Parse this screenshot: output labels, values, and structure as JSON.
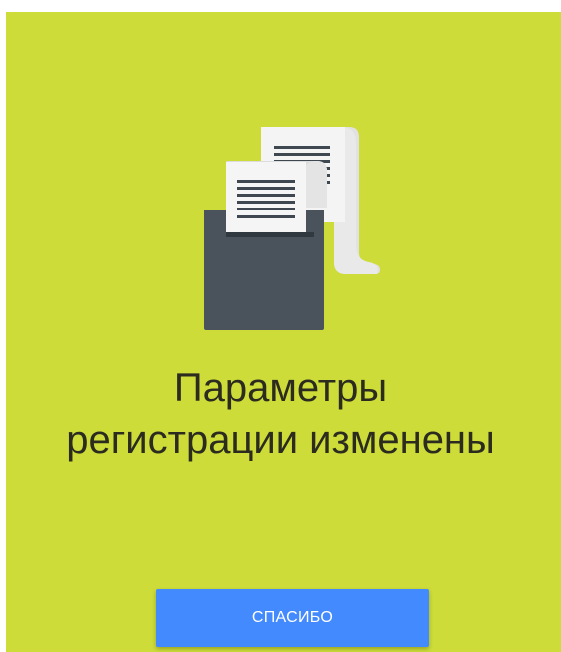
{
  "dialog": {
    "title_line_1": "Параметры",
    "title_line_2": "регистрации изменены",
    "button_label": "СПАСИБО",
    "illustration_icon": "receipt-printer-icon"
  },
  "colors": {
    "background": "#cddc39",
    "button": "#448aff",
    "printer": "#4a525b",
    "text": "#2b2b1f"
  }
}
